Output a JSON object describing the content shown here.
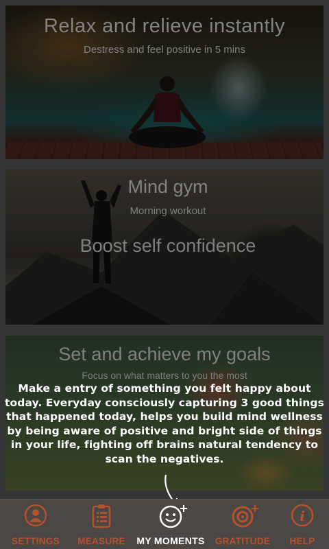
{
  "cards": [
    {
      "title": "Relax and relieve instantly",
      "subtitle": "Destress and feel positive in 5 mins"
    },
    {
      "title": "Mind gym",
      "subtitle": "Morning  workout",
      "extra": "Boost self confidence"
    },
    {
      "title": "Set and achieve my goals",
      "subtitle": "Focus on what matters to you the most"
    }
  ],
  "coach_mark": {
    "text": "Make a entry of something you felt happy about today. Everyday consciously capturing 3 good things that happened today, helps you build mind wellness by being aware of positive and bright side of things in your life, fighting off brains natural tendency to scan the negatives."
  },
  "tabs": [
    {
      "label": "SETTINGS",
      "icon": "person-icon"
    },
    {
      "label": "MEASURE",
      "icon": "clipboard-icon"
    },
    {
      "label": "MY MOMENTS",
      "icon": "smiley-plus-icon",
      "active": true
    },
    {
      "label": "GRATITUDE",
      "icon": "target-plus-icon"
    },
    {
      "label": "HELP",
      "icon": "info-icon"
    }
  ],
  "colors": {
    "accent": "#b5522c",
    "tabbar": "#4a4745",
    "active_label": "#ffffff"
  }
}
